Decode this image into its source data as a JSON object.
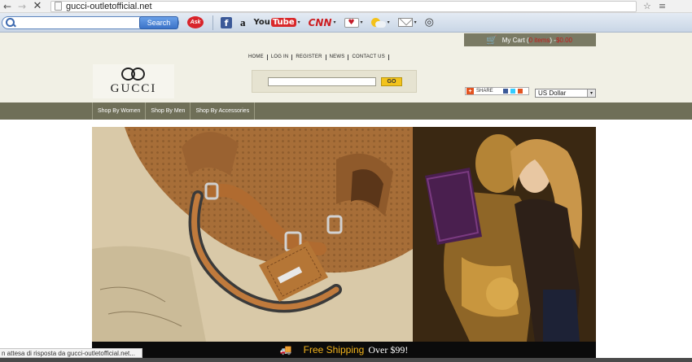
{
  "browser": {
    "url": "gucci-outletofficial.net",
    "back_glyph": "←",
    "forward_glyph": "→",
    "stop_glyph": "✕",
    "star_glyph": "☆",
    "menu_glyph": "≡",
    "status_text": "n attesa di risposta da gucci-outletofficial.net..."
  },
  "toolbar": {
    "search_label": "Search",
    "search_value": "",
    "ask_label": "Ask",
    "facebook_label": "f",
    "amazon_label": "a",
    "youtube_label_1": "You",
    "youtube_label_2": "Tube",
    "cnn_label": "CNN",
    "cards_label": "♥",
    "caret": "▾",
    "eye_label": "◎"
  },
  "site": {
    "cart_icon": "🛒",
    "cart_label": "My Cart (",
    "cart_items": "0 items",
    "cart_mid": ") - ",
    "cart_total": "$0.00",
    "logo_text": "GUCCI",
    "top_links": [
      "HOME",
      "LOG IN",
      "REGISTER",
      "NEWS",
      "CONTACT US"
    ],
    "search_value": "",
    "go_label": "GO",
    "share_label": "SHARE",
    "currency": "US Dollar",
    "nav": [
      "Shop By Women",
      "Shop By Men",
      "Shop By Accessories"
    ],
    "free_shipping_1": "Free Shipping",
    "free_shipping_2": "Over $99!",
    "truck_glyph": "🚚"
  },
  "colors": {
    "header_bg": "#f1f0e5",
    "nav_bg": "#6f6f58",
    "cart_bg": "#7a7a64",
    "go_button": "#f3c31c",
    "shipping_text": "#f3b41c"
  }
}
